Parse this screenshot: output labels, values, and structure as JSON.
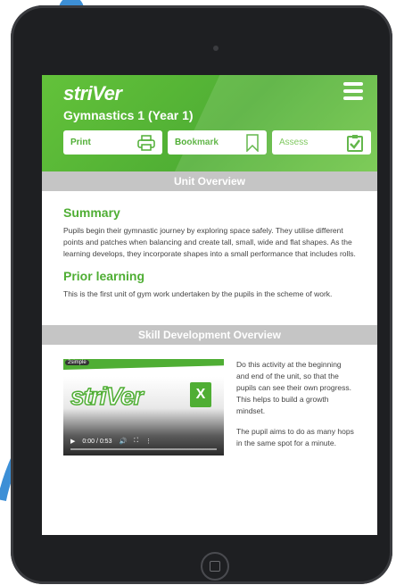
{
  "app": {
    "logo": "striVer"
  },
  "header": {
    "title": "Gymnastics 1 (Year 1)"
  },
  "actions": [
    {
      "label": "Print",
      "icon": "printer-icon"
    },
    {
      "label": "Bookmark",
      "icon": "bookmark-icon"
    },
    {
      "label": "Assess",
      "icon": "clipboard-check-icon"
    }
  ],
  "sections": {
    "unit_overview": "Unit Overview",
    "skill_overview": "Skill Development Overview"
  },
  "summary": {
    "heading": "Summary",
    "text": "Pupils begin their gymnastic journey by exploring space safely. They utilise different points and patches when balancing and create tall, small, wide and flat shapes. As the learning develops, they incorporate shapes into a small performance that includes rolls."
  },
  "prior": {
    "heading": "Prior learning",
    "text": "This is the first unit of gym work undertaken by the pupils in the scheme of work."
  },
  "video": {
    "tag": "2simple",
    "brand": "striVer",
    "badge": "X",
    "time": "0:00 / 0:53"
  },
  "skill": {
    "p1": "Do this activity at the beginning and end of the unit, so that the pupils can see their own progress. This helps to build a growth mindset.",
    "p2": "The pupil aims to do as many hops in the same spot for a minute."
  },
  "colors": {
    "brand_green": "#4fae34",
    "band_gray": "#c5c5c5",
    "tablet": "#1e1f22"
  }
}
